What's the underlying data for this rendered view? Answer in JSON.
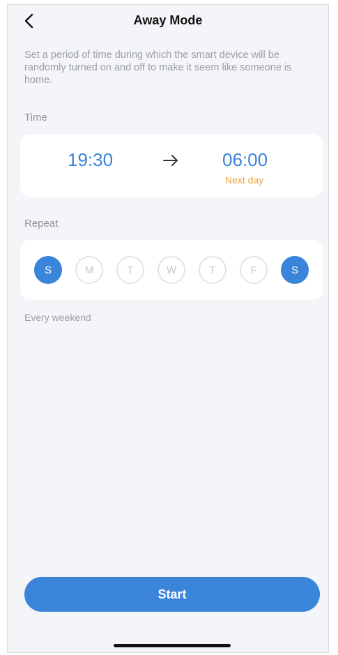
{
  "header": {
    "back_icon": "chevron-left-icon",
    "title": "Away Mode"
  },
  "description": "Set a period of time during which the smart device will be randomly turned on and off to make it seem like someone is home.",
  "time": {
    "label": "Time",
    "start": "19:30",
    "arrow_icon": "arrow-right-icon",
    "end": "06:00",
    "end_note": "Next day"
  },
  "repeat": {
    "label": "Repeat",
    "days": [
      {
        "label": "S",
        "selected": true
      },
      {
        "label": "M",
        "selected": false
      },
      {
        "label": "T",
        "selected": false
      },
      {
        "label": "W",
        "selected": false
      },
      {
        "label": "T",
        "selected": false
      },
      {
        "label": "F",
        "selected": false
      },
      {
        "label": "S",
        "selected": true
      }
    ],
    "summary": "Every weekend"
  },
  "start_button": "Start",
  "colors": {
    "accent": "#3a84d9",
    "next_day": "#f2a23a",
    "background": "#f4f5f9"
  }
}
